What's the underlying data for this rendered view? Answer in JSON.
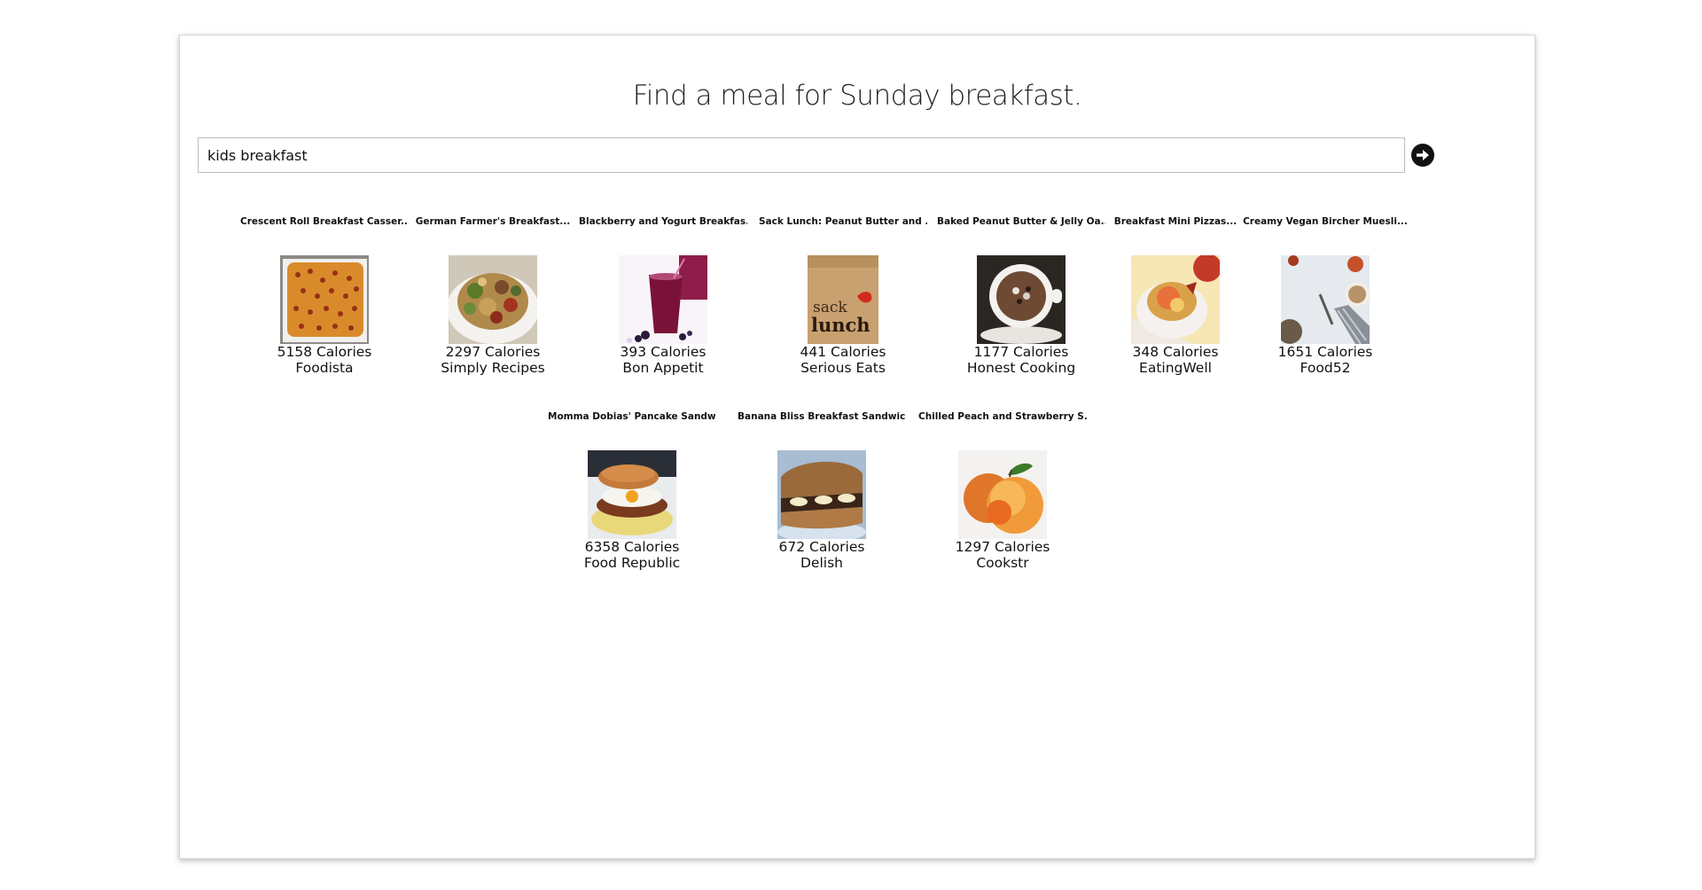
{
  "header": {
    "title": "Find a meal for Sunday breakfast."
  },
  "search": {
    "value": "kids breakfast",
    "submit_icon": "arrow-circle-right-icon"
  },
  "results": [
    {
      "name": "Crescent Roll Breakfast Casser...",
      "calories": "5158 Calories",
      "source": "Foodista",
      "image": "casserole-photo"
    },
    {
      "name": "German Farmer's Breakfast...",
      "calories": "2297 Calories",
      "source": "Simply Recipes",
      "image": "farmers-breakfast-photo"
    },
    {
      "name": "Blackberry and Yogurt Breakfas...",
      "calories": "393 Calories",
      "source": "Bon Appetit",
      "image": "smoothie-photo"
    },
    {
      "name": "Sack Lunch: Peanut Butter and ...",
      "calories": "441 Calories",
      "source": "Serious Eats",
      "image": "sack-lunch-photo",
      "image_text": [
        "sack",
        "lunch"
      ]
    },
    {
      "name": "Baked Peanut Butter & Jelly Oa...",
      "calories": "1177 Calories",
      "source": "Honest Cooking",
      "image": "oatmeal-cup-photo"
    },
    {
      "name": "Breakfast Mini Pizzas...",
      "calories": "348 Calories",
      "source": "EatingWell",
      "image": "mini-pizza-photo"
    },
    {
      "name": "Creamy Vegan Bircher Muesli...",
      "calories": "1651 Calories",
      "source": "Food52",
      "image": "muesli-photo"
    },
    {
      "name": "Momma Dobias' Pancake Sandwich...",
      "calories": "6358 Calories",
      "source": "Food Republic",
      "image": "pancake-sandwich-photo"
    },
    {
      "name": "Banana Bliss Breakfast Sandwic...",
      "calories": "672 Calories",
      "source": "Delish",
      "image": "banana-sandwich-photo"
    },
    {
      "name": "Chilled Peach and Strawberry S...",
      "calories": "1297 Calories",
      "source": "Cookstr",
      "image": "peach-photo"
    }
  ]
}
